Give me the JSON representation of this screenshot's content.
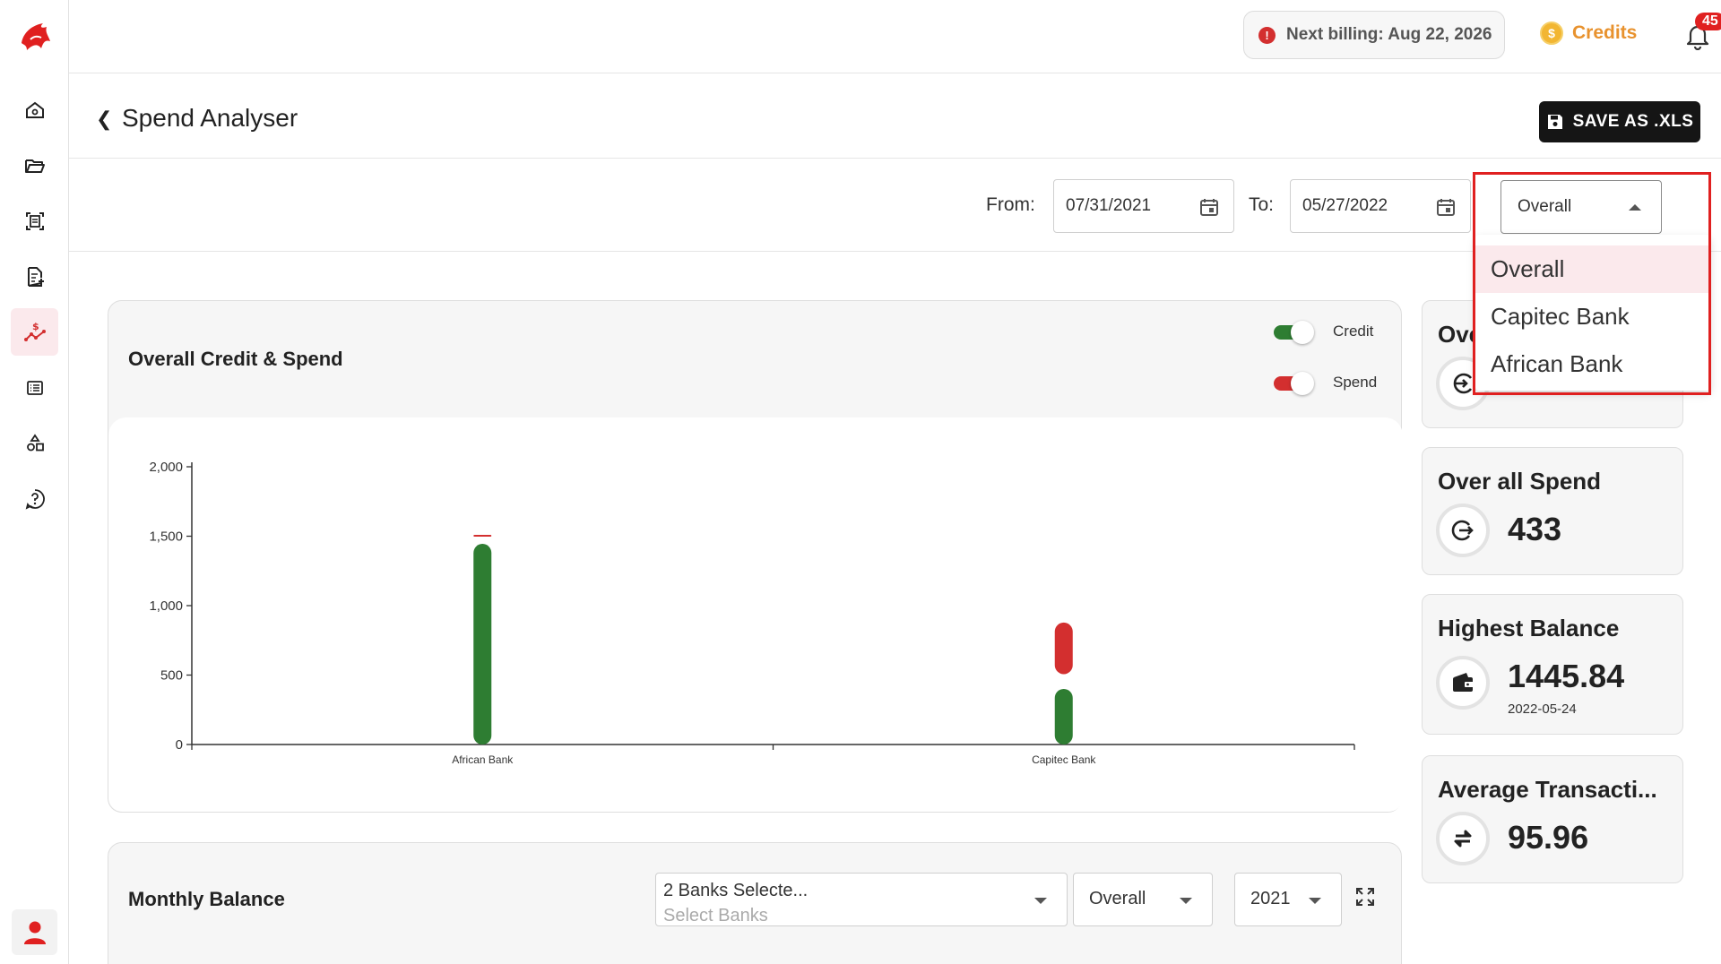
{
  "topbar": {
    "billing_text": "Next billing: Aug 22, 2026",
    "credits_label": "Credits",
    "notification_count": "45"
  },
  "header": {
    "title": "Spend Analyser",
    "save_label": "SAVE AS .XLS"
  },
  "filters": {
    "from_label": "From:",
    "from_value": "07/31/2021",
    "to_label": "To:",
    "to_value": "05/27/2022",
    "bank_select_value": "Overall",
    "dropdown_options": [
      "Overall",
      "Capitec Bank",
      "African Bank"
    ]
  },
  "credit_spend_card": {
    "title": "Overall Credit & Spend",
    "toggle_credit_label": "Credit",
    "toggle_spend_label": "Spend",
    "colors": {
      "credit": "#2e7d32",
      "spend": "#d32f2f"
    }
  },
  "chart_data": {
    "type": "bar",
    "title": "Overall Credit & Spend",
    "xlabel": "",
    "ylabel": "",
    "categories": [
      "African Bank",
      "Capitec Bank"
    ],
    "series": [
      {
        "name": "Credit",
        "values": [
          1445,
          400
        ]
      },
      {
        "name": "Spend",
        "values": [
          10,
          423
        ]
      }
    ],
    "ylim": [
      0,
      2000
    ],
    "yticks": [
      0,
      500,
      1000,
      1500,
      2000
    ],
    "ytick_labels": [
      "0",
      "500",
      "1,000",
      "1,500",
      "2,000"
    ]
  },
  "stats": [
    {
      "title": "Over all Credit",
      "value": "",
      "sub": ""
    },
    {
      "title": "Over all Spend",
      "value": "433",
      "sub": ""
    },
    {
      "title": "Highest Balance",
      "value": "1445.84",
      "sub": "2022-05-24"
    },
    {
      "title": "Average Transacti...",
      "value": "95.96",
      "sub": ""
    }
  ],
  "monthly": {
    "title": "Monthly Balance",
    "banks_value": "2 Banks Selecte...",
    "banks_placeholder": "Select Banks",
    "mode_value": "Overall",
    "year_value": "2021"
  }
}
